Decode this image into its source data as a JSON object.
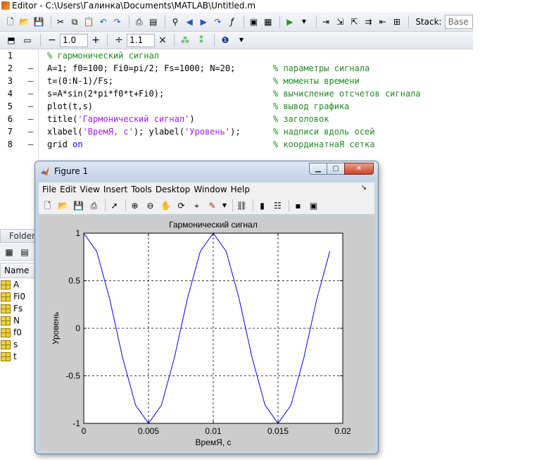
{
  "editor": {
    "title": "Editor - C:\\Users\\Галинка\\Documents\\MATLAB\\Untitled.m",
    "stack_label": "Stack:",
    "stack_value": "Base",
    "cell_decrement": "−",
    "cell_value_1": "1.0",
    "cell_increment": "+",
    "cell_divide": "÷",
    "cell_value_2": "1.1",
    "cell_multiply": "×"
  },
  "code_lines": [
    {
      "num": "1",
      "dash": "",
      "code": "% гармонический сигнал",
      "comment": ""
    },
    {
      "num": "2",
      "dash": "—",
      "code": "A=1; f0=100; Fi0=pi/2; Fs=1000; N=20;",
      "comment": "% параметры сигнала"
    },
    {
      "num": "3",
      "dash": "—",
      "code": "t=(0:N-1)/Fs;",
      "comment": "% моменты времени"
    },
    {
      "num": "4",
      "dash": "—",
      "code": "s=A*sin(2*pi*f0*t+Fi0);",
      "comment": "% вычисление отсчетов сигнала"
    },
    {
      "num": "5",
      "dash": "—",
      "code": "plot(t,s)",
      "comment": "% вывод графика"
    },
    {
      "num": "6",
      "dash": "—",
      "code_pre": "title(",
      "code_str": "'Гармонический сигнал'",
      "code_post": ")",
      "comment": "% заголовок"
    },
    {
      "num": "7",
      "dash": "—",
      "code_pre": "xlabel(",
      "code_str": "'ВремЯ, с'",
      "code_mid": "); ylabel(",
      "code_str2": "'Уровень'",
      "code_post": ");",
      "comment": "% надписи вдоль осей"
    },
    {
      "num": "8",
      "dash": "—",
      "code_pre": "grid ",
      "code_kw": "on",
      "comment": "% координатнаЯ сетка"
    }
  ],
  "folder_tab": "Folder",
  "workspace": {
    "header": "Name",
    "variables": [
      "A",
      "Fi0",
      "Fs",
      "N",
      "f0",
      "s",
      "t"
    ]
  },
  "figure": {
    "title": "Figure 1",
    "menu": [
      "File",
      "Edit",
      "View",
      "Insert",
      "Tools",
      "Desktop",
      "Window",
      "Help"
    ],
    "dock_glyph": "↘"
  },
  "chart_data": {
    "type": "line",
    "title": "Гармонический сигнал",
    "xlabel": "ВремЯ, с",
    "ylabel": "Уровень",
    "xlim": [
      0,
      0.02
    ],
    "ylim": [
      -1,
      1
    ],
    "xticks": [
      0,
      0.005,
      0.01,
      0.015,
      0.02
    ],
    "xtick_labels": [
      "0",
      "0.005",
      "0.01",
      "0.015",
      "0.02"
    ],
    "yticks": [
      -1,
      -0.5,
      0,
      0.5,
      1
    ],
    "ytick_labels": [
      "-1",
      "-0.5",
      "0",
      "0.5",
      "1"
    ],
    "grid": true,
    "line_color": "#0000ff",
    "x": [
      0,
      0.001,
      0.002,
      0.003,
      0.004,
      0.005,
      0.006,
      0.007,
      0.008,
      0.009,
      0.01,
      0.011,
      0.012,
      0.013,
      0.014,
      0.015,
      0.016,
      0.017,
      0.018,
      0.019
    ],
    "y": [
      1,
      0.809,
      0.309,
      -0.309,
      -0.809,
      -1,
      -0.809,
      -0.309,
      0.309,
      0.809,
      1,
      0.809,
      0.309,
      -0.309,
      -0.809,
      -1,
      -0.809,
      -0.309,
      0.309,
      0.809
    ]
  }
}
